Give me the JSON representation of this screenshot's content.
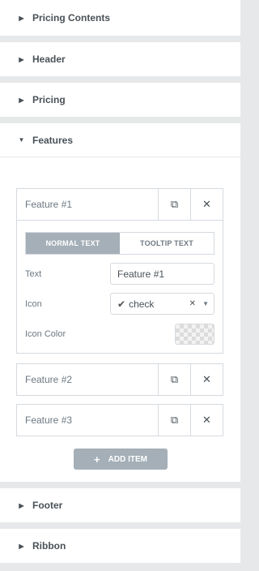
{
  "sections": {
    "pricing_contents": "Pricing Contents",
    "header": "Header",
    "pricing": "Pricing",
    "features": "Features",
    "footer": "Footer",
    "ribbon": "Ribbon"
  },
  "features": {
    "items": [
      {
        "title": "Feature #1"
      },
      {
        "title": "Feature #2"
      },
      {
        "title": "Feature #3"
      }
    ],
    "tabs": {
      "normal": "NORMAL TEXT",
      "tooltip": "TOOLTIP TEXT"
    },
    "fields": {
      "text_label": "Text",
      "text_value": "Feature #1",
      "icon_label": "Icon",
      "icon_value": "check",
      "icon_color_label": "Icon Color"
    },
    "add_item": "ADD ITEM"
  },
  "colors": {
    "accent": "#a4afb7",
    "border": "#d5dadf",
    "background": "#e6e8ea"
  }
}
